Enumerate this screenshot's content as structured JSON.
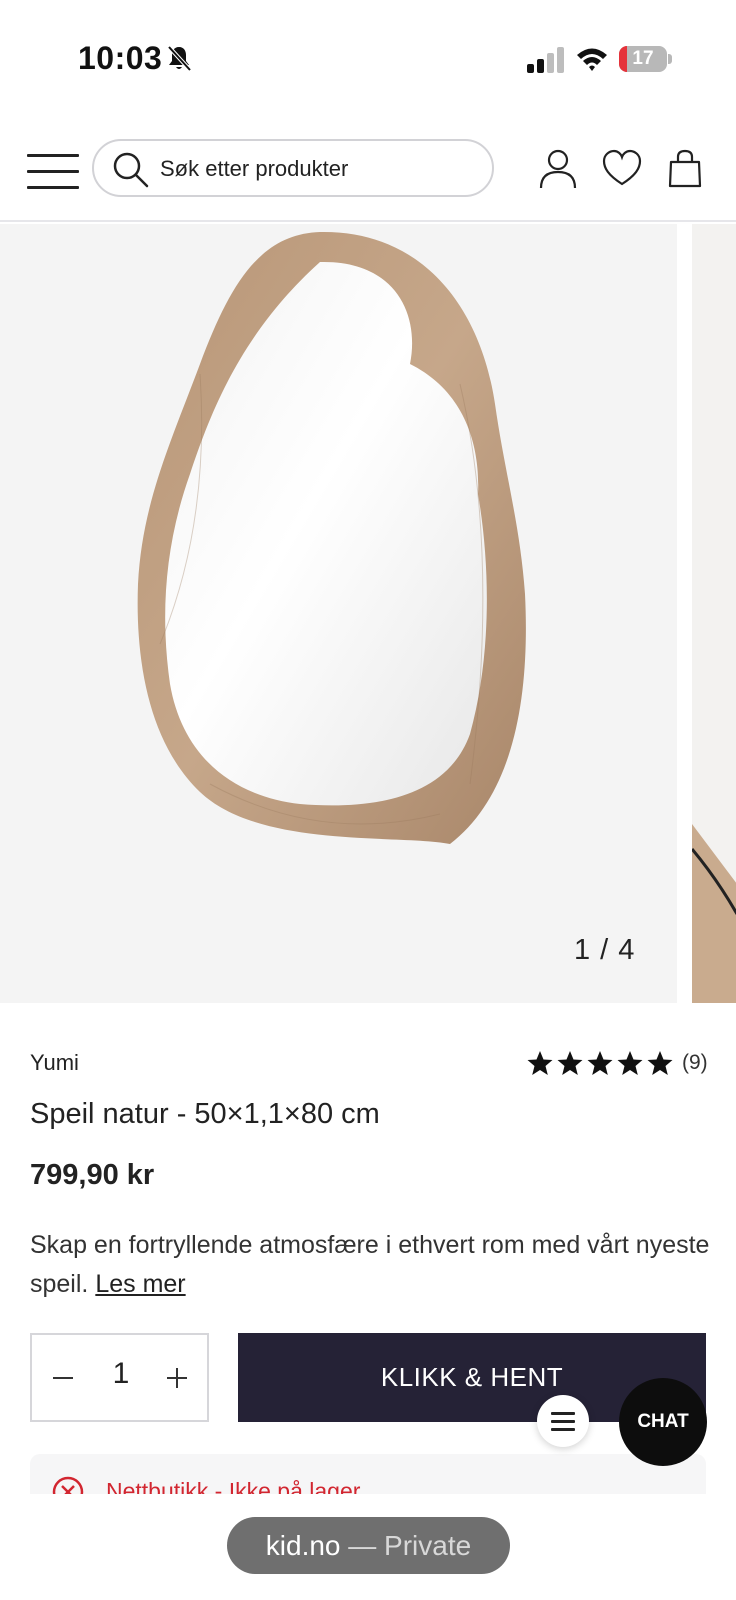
{
  "status_bar": {
    "time": "10:03",
    "battery_percent": "17",
    "battery_level": 0.17,
    "battery_color": "#e5333b"
  },
  "header": {
    "search_placeholder": "Søk etter produkter",
    "icons": [
      "menu-icon",
      "search-icon",
      "account-icon",
      "heart-icon",
      "bag-icon"
    ]
  },
  "gallery": {
    "counter": "1 / 4"
  },
  "product": {
    "brand": "Yumi",
    "rating_stars": 5,
    "rating_count": "(9)",
    "title": "Speil natur - 50×1,1×80 cm",
    "price": "799,90 kr",
    "description": "Skap en fortryllende atmosfære i ethvert rom med vårt nyeste speil.",
    "read_more": "Les mer"
  },
  "purchase": {
    "quantity": "1",
    "cta_label": "KLIKK & HENT",
    "cta_color": "#252236"
  },
  "floating": {
    "chat_label": "CHAT"
  },
  "stock": {
    "status_text": "Nettbutikk - Ikke på lager",
    "status_color": "#d22630"
  },
  "browser": {
    "domain": "kid.no",
    "mode": " — Private"
  }
}
